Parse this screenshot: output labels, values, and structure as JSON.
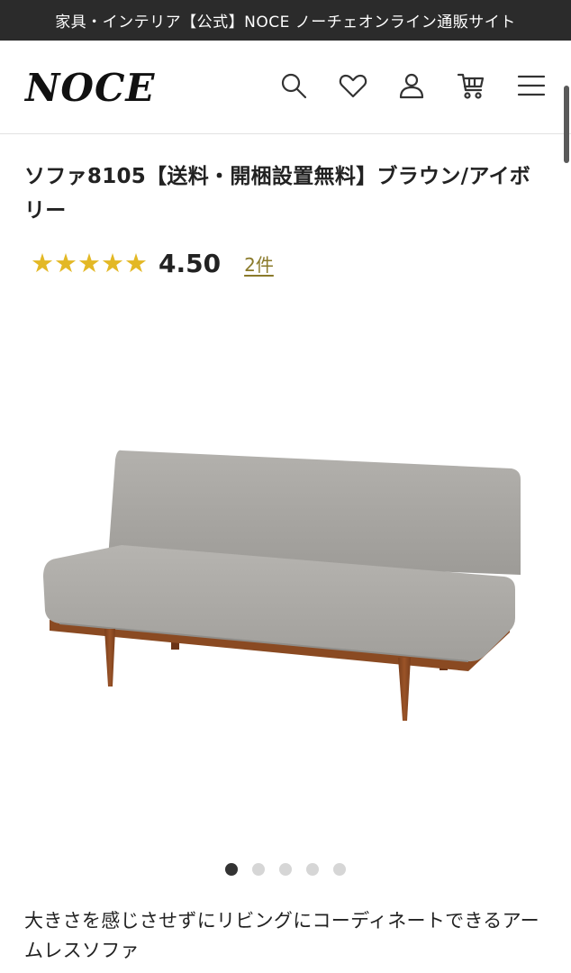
{
  "topbar": {
    "text": "家具・インテリア【公式】NOCE ノーチェオンライン通販サイト"
  },
  "header": {
    "logo": "NOCE",
    "icons": [
      "search-icon",
      "heart-icon",
      "user-icon",
      "cart-icon",
      "menu-icon"
    ]
  },
  "product": {
    "title": "ソファ8105【送料・開梱設置無料】ブラウン/アイボリー",
    "rating": {
      "stars": 4.5,
      "score": "4.50",
      "review_count": "2件"
    },
    "image_count": 5,
    "active_image": 1,
    "description": "大きさを感じさせずにリビングにコーディネートできるアームレスソファ"
  },
  "colors": {
    "topbar_bg": "#2b2b2b",
    "star": "#e3b825",
    "fabric": "#a9a7a3",
    "wood": "#8a4a22"
  }
}
